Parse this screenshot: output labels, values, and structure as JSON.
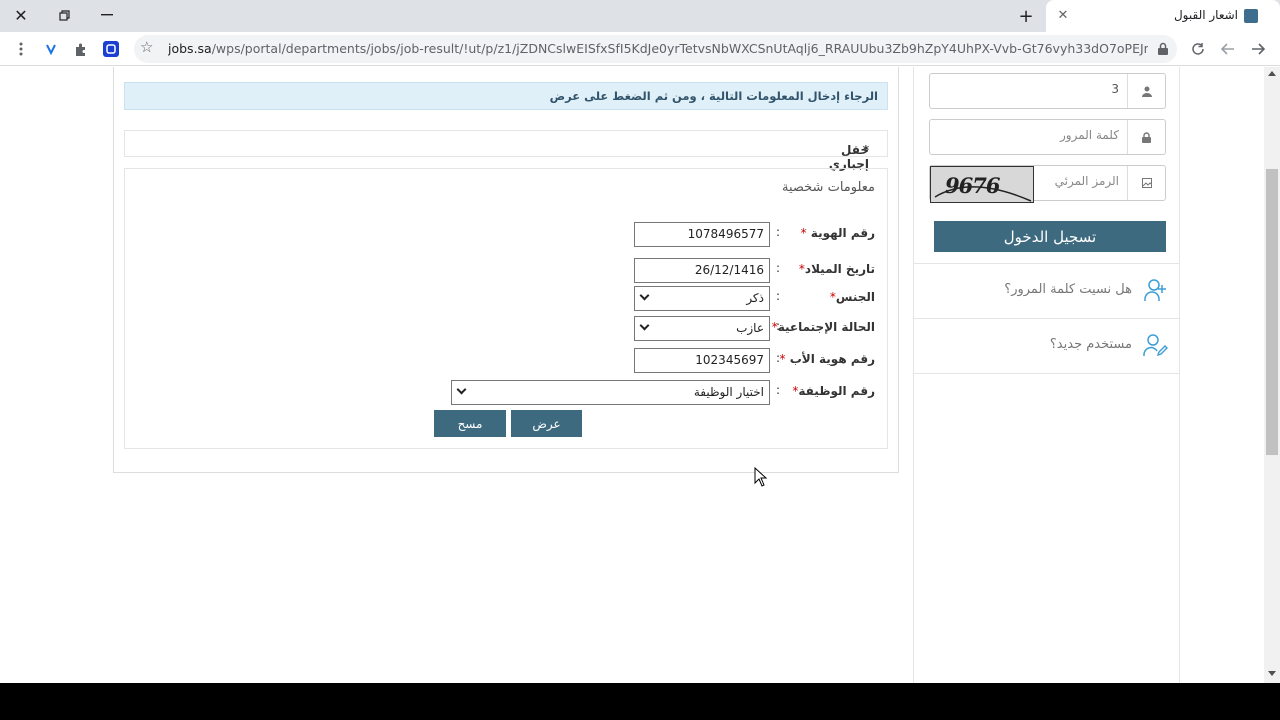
{
  "browser": {
    "tab_title": "اشعار القبول",
    "url_host": "jobs.sa",
    "url_path": "/wps/portal/departments/jobs/job-result/!ut/p/z1/jZDNCslwEISfxSfI5KdJe0yrTetvsNbWXCSnUtAqlj6_RRAUUbu3Zb9hZpY4UhPX-Vvb-Gt76vyh33dO7oPEJnm44HS..."
  },
  "sidebar": {
    "username_value": "3",
    "password_placeholder": "كلمة المرور",
    "captcha_placeholder": "الرمز المرئي",
    "captcha_text": "9676",
    "login_label": "تسجيل الدخول",
    "forgot_label": "هل نسيت كلمة المرور؟",
    "new_user_label": "مستخدم جديد؟"
  },
  "main": {
    "info_text": "الرجاء إدخال المعلومات التالية ، ومن ثم الضغط على عرض",
    "required_text": "حقل إجباري",
    "section_title": "معلومات شخصية",
    "fields": {
      "id_label": "رقم الهوية",
      "id_value": "1078496577",
      "dob_label": "تاريخ الميلاد",
      "dob_value": "26/12/1416",
      "gender_label": "الجنس",
      "gender_value": "ذكر",
      "marital_label": "الحالة الإجتماعية",
      "marital_value": "عازب",
      "father_id_label": "رقم هوية الأب",
      "father_id_value": "102345697",
      "job_label": "رقم الوظيفة",
      "job_value": "اختيار الوظيفة"
    },
    "colon": ":",
    "star": "*",
    "show_label": "عرض",
    "clear_label": "مسح"
  },
  "colors": {
    "accent": "#3e6a80",
    "info_bg": "#e0f0f8"
  }
}
